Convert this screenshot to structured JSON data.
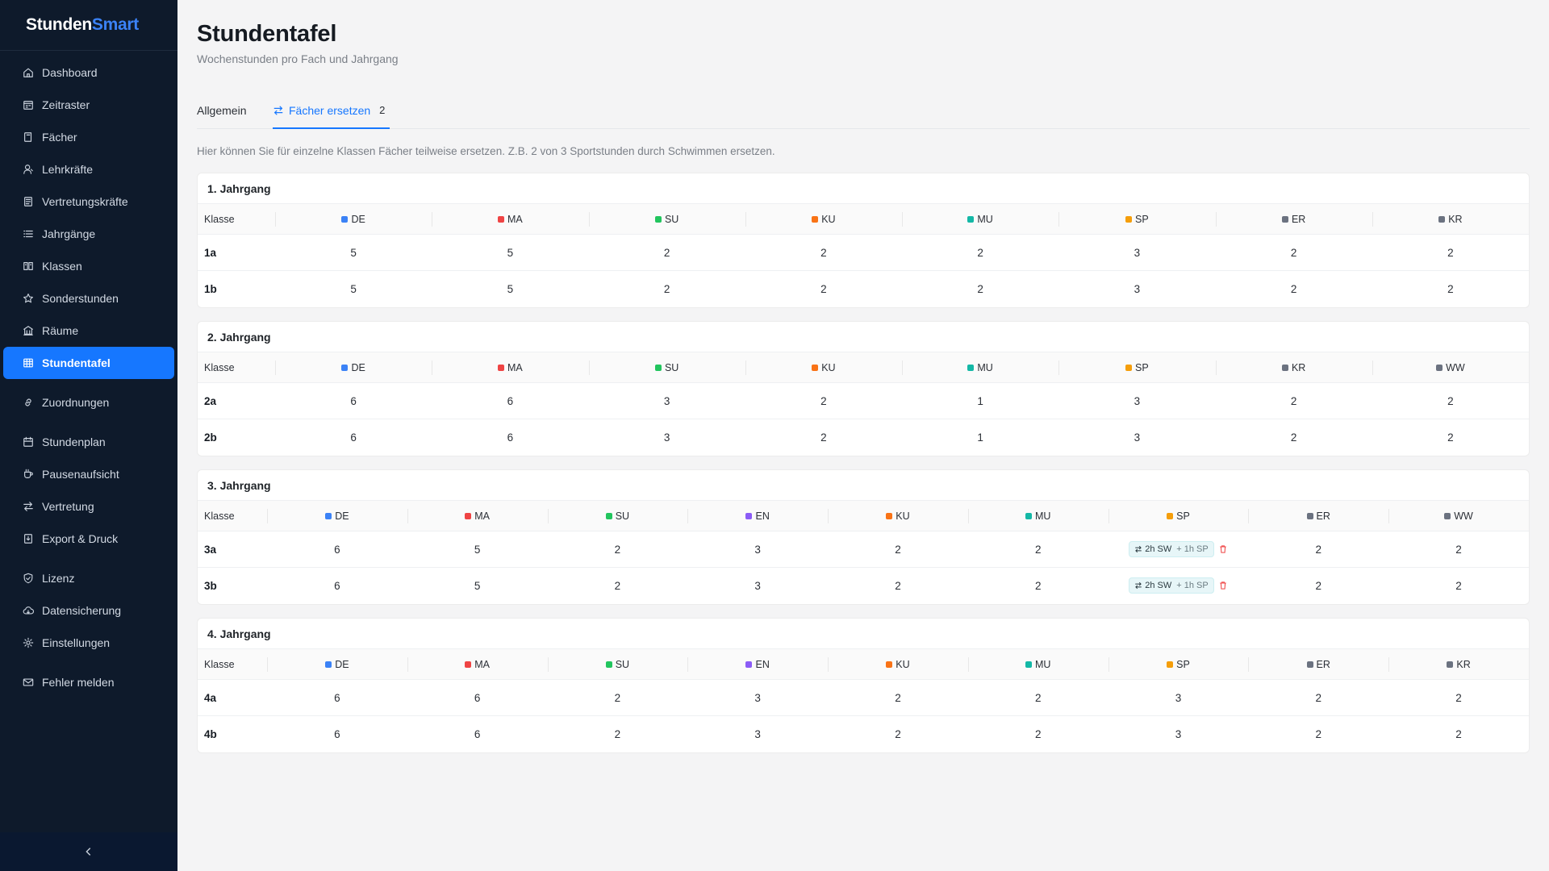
{
  "brand": {
    "part1": "Stunden",
    "part2": "Smart"
  },
  "sidebar": {
    "items": [
      {
        "label": "Dashboard",
        "icon": "home-icon"
      },
      {
        "label": "Zeitraster",
        "icon": "calendar-grid-icon"
      },
      {
        "label": "Fächer",
        "icon": "book-icon"
      },
      {
        "label": "Lehrkräfte",
        "icon": "user-icon"
      },
      {
        "label": "Vertretungskräfte",
        "icon": "document-list-icon"
      },
      {
        "label": "Jahrgänge",
        "icon": "list-icon"
      },
      {
        "label": "Klassen",
        "icon": "open-book-icon"
      },
      {
        "label": "Sonderstunden",
        "icon": "star-icon"
      },
      {
        "label": "Räume",
        "icon": "building-icon"
      },
      {
        "label": "Stundentafel",
        "icon": "table-icon"
      },
      {
        "label": "Zuordnungen",
        "icon": "link-icon"
      },
      {
        "label": "Stundenplan",
        "icon": "calendar-icon"
      },
      {
        "label": "Pausenaufsicht",
        "icon": "cup-icon"
      },
      {
        "label": "Vertretung",
        "icon": "swap-icon"
      },
      {
        "label": "Export & Druck",
        "icon": "export-icon"
      },
      {
        "label": "Lizenz",
        "icon": "shield-icon"
      },
      {
        "label": "Datensicherung",
        "icon": "cloud-icon"
      },
      {
        "label": "Einstellungen",
        "icon": "gear-icon"
      },
      {
        "label": "Fehler melden",
        "icon": "mail-icon"
      }
    ],
    "active": "Stundentafel"
  },
  "page": {
    "title": "Stundentafel",
    "subtitle": "Wochenstunden pro Fach und Jahrgang"
  },
  "tabs": [
    {
      "label": "Allgemein"
    },
    {
      "label": "Fächer ersetzen",
      "count": "2",
      "active": true
    }
  ],
  "info_text": "Hier können Sie für einzelne Klassen Fächer teilweise ersetzen. Z.B. 2 von 3 Sportstunden durch Schwimmen ersetzen.",
  "subject_colors": {
    "DE": "#3b82f6",
    "MA": "#ef4444",
    "SU": "#22c55e",
    "EN": "#8b5cf6",
    "KU": "#f97316",
    "MU": "#14b8a6",
    "SP": "#f59e0b",
    "ER": "#6b7280",
    "KR": "#6b7280",
    "WW": "#6b7280"
  },
  "class_header": "Klasse",
  "groups": [
    {
      "title": "1. Jahrgang",
      "subjects": [
        "DE",
        "MA",
        "SU",
        "KU",
        "MU",
        "SP",
        "ER",
        "KR"
      ],
      "rows": [
        {
          "class": "1a",
          "values": [
            "5",
            "5",
            "2",
            "2",
            "2",
            "3",
            "2",
            "2"
          ]
        },
        {
          "class": "1b",
          "values": [
            "5",
            "5",
            "2",
            "2",
            "2",
            "3",
            "2",
            "2"
          ]
        }
      ]
    },
    {
      "title": "2. Jahrgang",
      "subjects": [
        "DE",
        "MA",
        "SU",
        "KU",
        "MU",
        "SP",
        "KR",
        "WW"
      ],
      "rows": [
        {
          "class": "2a",
          "values": [
            "6",
            "6",
            "3",
            "2",
            "1",
            "3",
            "2",
            "2"
          ]
        },
        {
          "class": "2b",
          "values": [
            "6",
            "6",
            "3",
            "2",
            "1",
            "3",
            "2",
            "2"
          ]
        }
      ]
    },
    {
      "title": "3. Jahrgang",
      "subjects": [
        "DE",
        "MA",
        "SU",
        "EN",
        "KU",
        "MU",
        "SP",
        "ER",
        "WW"
      ],
      "rows": [
        {
          "class": "3a",
          "values": [
            "6",
            "5",
            "2",
            "3",
            "2",
            "2",
            {
              "replace": "2h SW",
              "rest": "+ 1h SP"
            },
            "2",
            "2"
          ]
        },
        {
          "class": "3b",
          "values": [
            "6",
            "5",
            "2",
            "3",
            "2",
            "2",
            {
              "replace": "2h SW",
              "rest": "+ 1h SP"
            },
            "2",
            "2"
          ]
        }
      ]
    },
    {
      "title": "4. Jahrgang",
      "subjects": [
        "DE",
        "MA",
        "SU",
        "EN",
        "KU",
        "MU",
        "SP",
        "ER",
        "KR"
      ],
      "rows": [
        {
          "class": "4a",
          "values": [
            "6",
            "6",
            "2",
            "3",
            "2",
            "2",
            "3",
            "2",
            "2"
          ]
        },
        {
          "class": "4b",
          "values": [
            "6",
            "6",
            "2",
            "3",
            "2",
            "2",
            "3",
            "2",
            "2"
          ]
        }
      ]
    }
  ]
}
